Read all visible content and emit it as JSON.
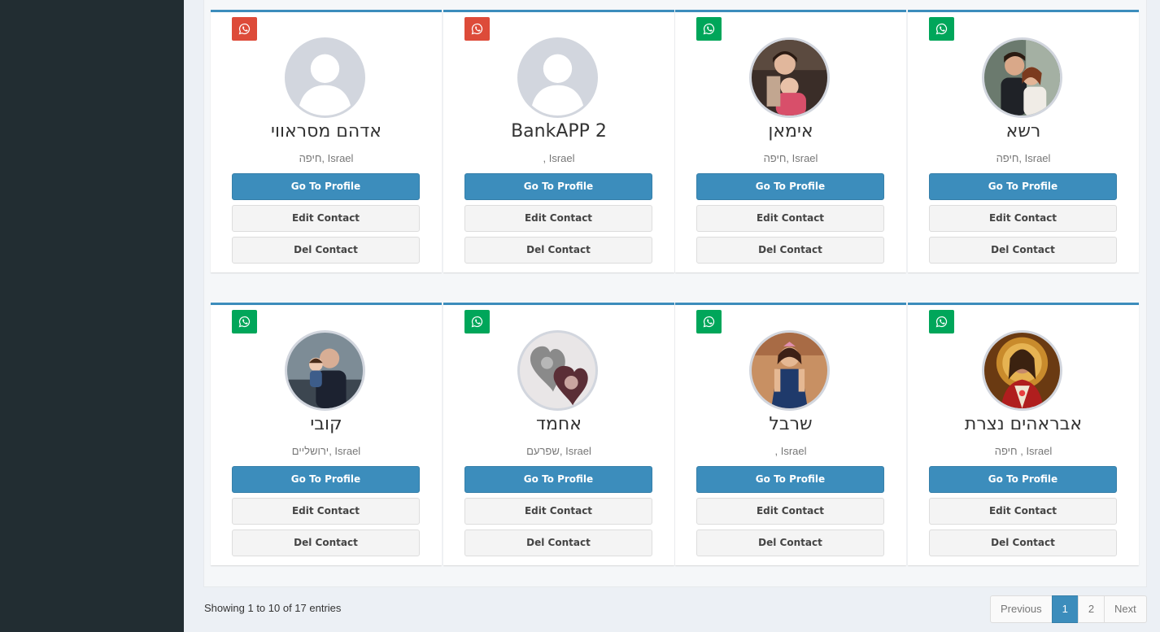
{
  "contacts": [
    {
      "name": "אדהם מסראווי",
      "location": "חיפה, Israel",
      "whatsapp_color": "red",
      "avatar": "default-avatar"
    },
    {
      "name": "BankAPP 2",
      "location": ", Israel",
      "whatsapp_color": "red",
      "avatar": "default-avatar"
    },
    {
      "name": "אימאן",
      "location": "חיפה, Israel",
      "whatsapp_color": "green",
      "avatar": "photo-children"
    },
    {
      "name": "רשא",
      "location": "חיפה, Israel",
      "whatsapp_color": "green",
      "avatar": "photo-couple"
    },
    {
      "name": "קובי",
      "location": "ירושליים, Israel",
      "whatsapp_color": "green",
      "avatar": "photo-man-with-child"
    },
    {
      "name": "אחמד",
      "location": "שפרעם, Israel",
      "whatsapp_color": "green",
      "avatar": "photo-hearts"
    },
    {
      "name": "שרבל",
      "location": ", Israel",
      "whatsapp_color": "green",
      "avatar": "photo-girl"
    },
    {
      "name": "אבראהים נצרת",
      "location": "חיפה , Israel",
      "whatsapp_color": "green",
      "avatar": "photo-icon-portrait"
    }
  ],
  "buttons": {
    "profile": "Go To Profile",
    "edit": "Edit Contact",
    "del": "Del Contact"
  },
  "icons": {
    "whatsapp": "whatsapp-icon"
  },
  "colors": {
    "primary": "#3c8dbc",
    "whatsapp_red": "#dd4b39",
    "whatsapp_green": "#00a65a",
    "sidebar": "#222d32"
  },
  "table_info": "Showing 1 to 10 of 17 entries",
  "pagination": {
    "previous": "Previous",
    "pages": [
      "1",
      "2"
    ],
    "active": "1",
    "next": "Next"
  }
}
